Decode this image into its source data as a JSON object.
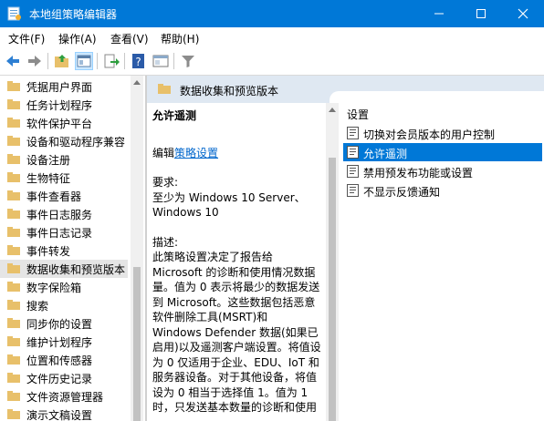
{
  "window": {
    "title": "本地组策略编辑器"
  },
  "menu": [
    "文件(F)",
    "操作(A)",
    "查看(V)",
    "帮助(H)"
  ],
  "tree": {
    "items": [
      {
        "label": "凭据用户界面"
      },
      {
        "label": "任务计划程序"
      },
      {
        "label": "软件保护平台"
      },
      {
        "label": "设备和驱动程序兼容"
      },
      {
        "label": "设备注册"
      },
      {
        "label": "生物特征"
      },
      {
        "label": "事件查看器"
      },
      {
        "label": "事件日志服务"
      },
      {
        "label": "事件日志记录"
      },
      {
        "label": "事件转发"
      },
      {
        "label": "数据收集和预览版本"
      },
      {
        "label": "数字保险箱"
      },
      {
        "label": "搜索"
      },
      {
        "label": "同步你的设置"
      },
      {
        "label": "维护计划程序"
      },
      {
        "label": "位置和传感器"
      },
      {
        "label": "文件历史记录"
      },
      {
        "label": "文件资源管理器"
      },
      {
        "label": "演示文稿设置"
      }
    ],
    "selected_index": 10
  },
  "right_pane": {
    "header_title": "数据收集和预览版本",
    "description": {
      "title": "允许遥测",
      "edit_prefix": "编辑",
      "edit_link": "策略设置",
      "requirements_label": "要求:",
      "requirements_lines": [
        "至少为 Windows 10 Server、",
        "Windows 10"
      ],
      "description_label": "描述:",
      "description_lines": [
        "此策略设置决定了报告给",
        "Microsoft 的诊断和使用情况数据",
        "量。值为 0 表示将最少的数据发送",
        "到 Microsoft。这些数据包括恶意",
        "软件删除工具(MSRT)和",
        "Windows Defender 数据(如果已",
        "启用)以及遥测客户端设置。将值设",
        "为 0 仅适用于企业、EDU、IoT 和",
        "服务器设备。对于其他设备，将值",
        "设为 0 相当于选择值 1。值为 1",
        "时，只发送基本数量的诊断和使用"
      ]
    },
    "settings": {
      "header": "设置",
      "items": [
        {
          "label": "切换对会员版本的用户控制"
        },
        {
          "label": "允许遥测"
        },
        {
          "label": "禁用预发布功能或设置"
        },
        {
          "label": "不显示反馈通知"
        }
      ],
      "selected_index": 1
    }
  },
  "colors": {
    "titlebar": "#0078d7",
    "selection": "#0078d7",
    "folder": "#e8c06a",
    "link": "#0066cc"
  }
}
